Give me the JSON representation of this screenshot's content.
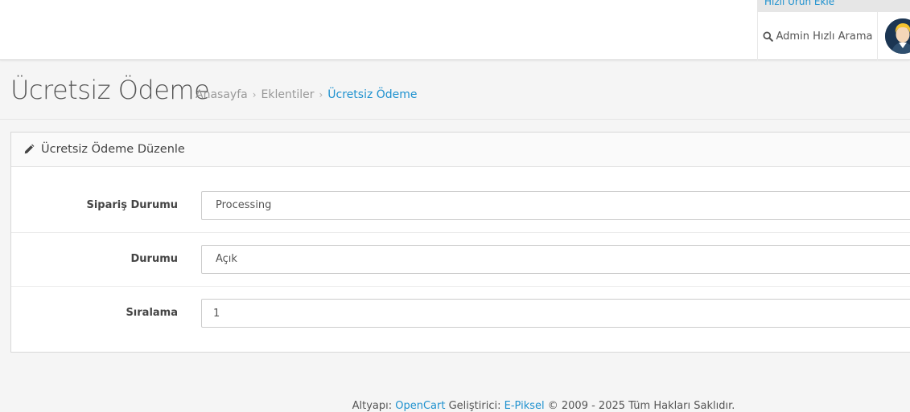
{
  "header": {
    "quick_add_label": "Hızlı Ürün Ekle",
    "admin_search_label": "Admin Hızlı Arama"
  },
  "page": {
    "title": "Ücretsiz Ödeme",
    "breadcrumb": [
      {
        "label": "Anasayfa"
      },
      {
        "label": "Eklentiler"
      },
      {
        "label": "Ücretsiz Ödeme"
      }
    ],
    "breadcrumb_separator": "›"
  },
  "panel": {
    "heading": "Ücretsiz Ödeme Düzenle",
    "fields": [
      {
        "label": "Sipariş Durumu",
        "value": "Processing"
      },
      {
        "label": "Durumu",
        "value": "Açık"
      },
      {
        "label": "Sıralama",
        "value": "1"
      }
    ]
  },
  "footer": {
    "prefix": "Altyapı:",
    "platform_link": "OpenCart",
    "developer_prefix": "Geliştirici:",
    "developer_link": "E-Piksel",
    "copyright": "© 2009 - 2025 Tüm Hakları Saklıdır."
  },
  "colors": {
    "accent": "#1e91cf",
    "background": "#f5f5f5"
  },
  "icons": {
    "search": "search-icon",
    "pencil": "pencil-icon",
    "avatar": "user-avatar"
  }
}
